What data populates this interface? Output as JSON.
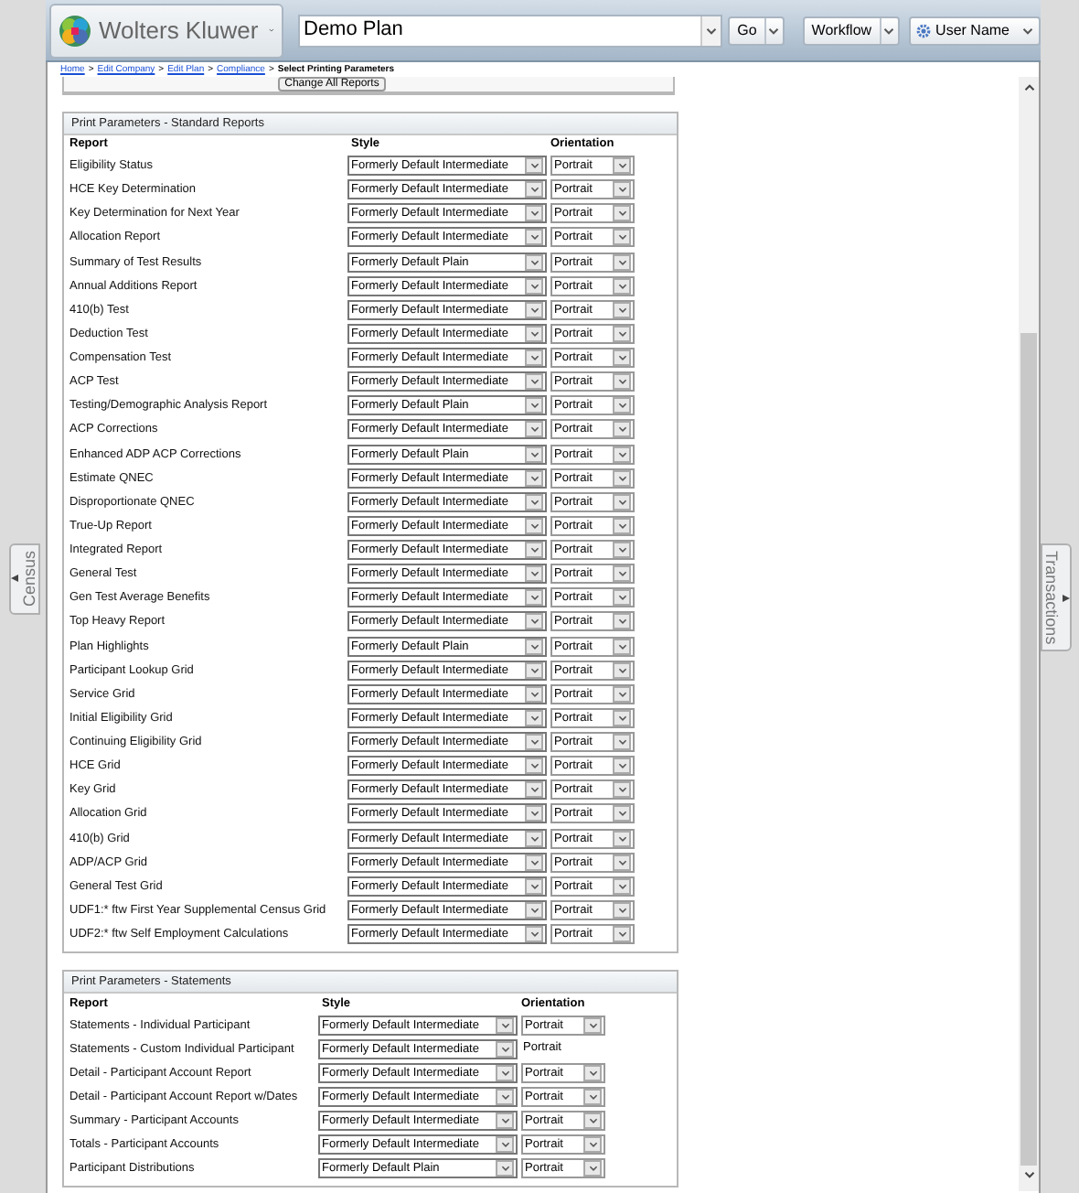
{
  "header": {
    "brand": "Wolters Kluwer",
    "plan_field": {
      "value": "Demo Plan"
    },
    "go_button": "Go",
    "workflow_button": "Workflow",
    "user_menu": "User Name"
  },
  "breadcrumb": [
    {
      "label": "Home",
      "link": true
    },
    {
      "separator": ">",
      "label": "Edit Company",
      "link": true
    },
    {
      "separator": ">",
      "label": "Edit Plan",
      "link": true
    },
    {
      "separator": ">",
      "label": "Compliance",
      "link": true
    },
    {
      "separator": ">",
      "label": "Select Printing Parameters",
      "link": false
    }
  ],
  "change_all_button": "Change All Reports",
  "standard_reports": {
    "title": "Print Parameters - Standard Reports",
    "columns": [
      "Report",
      "Style",
      "Orientation"
    ],
    "rows": [
      {
        "report": "Eligibility Status",
        "style": "Formerly Default Intermediate",
        "orientation": {
          "value": "Portrait",
          "kind": "select"
        }
      },
      {
        "report": "HCE Key Determination",
        "style": "Formerly Default Intermediate",
        "orientation": {
          "value": "Portrait",
          "kind": "select"
        }
      },
      {
        "report": "Key Determination for Next Year",
        "style": "Formerly Default Intermediate",
        "orientation": {
          "value": "Portrait",
          "kind": "select"
        }
      },
      {
        "report": "Allocation Report",
        "style": "Formerly Default Intermediate",
        "orientation": {
          "value": "Portrait",
          "kind": "select"
        }
      },
      {
        "report": "Summary of Test Results",
        "style": "Formerly Default Plain",
        "orientation": {
          "value": "Portrait",
          "kind": "select"
        }
      },
      {
        "report": "Annual Additions Report",
        "style": "Formerly Default Intermediate",
        "orientation": {
          "value": "Portrait",
          "kind": "select"
        }
      },
      {
        "report": "410(b) Test",
        "style": "Formerly Default Intermediate",
        "orientation": {
          "value": "Portrait",
          "kind": "select"
        }
      },
      {
        "report": "Deduction Test",
        "style": "Formerly Default Intermediate",
        "orientation": {
          "value": "Portrait",
          "kind": "select"
        }
      },
      {
        "report": "Compensation Test",
        "style": "Formerly Default Intermediate",
        "orientation": {
          "value": "Portrait",
          "kind": "select"
        }
      },
      {
        "report": "ACP Test",
        "style": "Formerly Default Intermediate",
        "orientation": {
          "value": "Portrait",
          "kind": "select"
        }
      },
      {
        "report": "Testing/Demographic Analysis Report",
        "style": "Formerly Default Plain",
        "orientation": {
          "value": "Portrait",
          "kind": "select"
        }
      },
      {
        "report": "ACP Corrections",
        "style": "Formerly Default Intermediate",
        "orientation": {
          "value": "Portrait",
          "kind": "select"
        }
      },
      {
        "report": "Enhanced ADP ACP Corrections",
        "style": "Formerly Default Plain",
        "orientation": {
          "value": "Portrait",
          "kind": "select"
        }
      },
      {
        "report": "Estimate QNEC",
        "style": "Formerly Default Intermediate",
        "orientation": {
          "value": "Portrait",
          "kind": "select"
        }
      },
      {
        "report": "Disproportionate QNEC",
        "style": "Formerly Default Intermediate",
        "orientation": {
          "value": "Portrait",
          "kind": "select"
        }
      },
      {
        "report": "True-Up Report",
        "style": "Formerly Default Intermediate",
        "orientation": {
          "value": "Portrait",
          "kind": "select"
        }
      },
      {
        "report": "Integrated Report",
        "style": "Formerly Default Intermediate",
        "orientation": {
          "value": "Portrait",
          "kind": "select"
        }
      },
      {
        "report": "General Test",
        "style": "Formerly Default Intermediate",
        "orientation": {
          "value": "Portrait",
          "kind": "select"
        }
      },
      {
        "report": "Gen Test Average Benefits",
        "style": "Formerly Default Intermediate",
        "orientation": {
          "value": "Portrait",
          "kind": "select"
        }
      },
      {
        "report": "Top Heavy Report",
        "style": "Formerly Default Intermediate",
        "orientation": {
          "value": "Portrait",
          "kind": "select"
        }
      },
      {
        "report": "Plan Highlights",
        "style": "Formerly Default Plain",
        "orientation": {
          "value": "Portrait",
          "kind": "select"
        }
      },
      {
        "report": "Participant Lookup Grid",
        "style": "Formerly Default Intermediate",
        "orientation": {
          "value": "Portrait",
          "kind": "select"
        }
      },
      {
        "report": "Service Grid",
        "style": "Formerly Default Intermediate",
        "orientation": {
          "value": "Portrait",
          "kind": "select"
        }
      },
      {
        "report": "Initial Eligibility Grid",
        "style": "Formerly Default Intermediate",
        "orientation": {
          "value": "Portrait",
          "kind": "select"
        }
      },
      {
        "report": "Continuing Eligibility Grid",
        "style": "Formerly Default Intermediate",
        "orientation": {
          "value": "Portrait",
          "kind": "select"
        }
      },
      {
        "report": "HCE Grid",
        "style": "Formerly Default Intermediate",
        "orientation": {
          "value": "Portrait",
          "kind": "select"
        }
      },
      {
        "report": "Key Grid",
        "style": "Formerly Default Intermediate",
        "orientation": {
          "value": "Portrait",
          "kind": "select"
        }
      },
      {
        "report": "Allocation Grid",
        "style": "Formerly Default Intermediate",
        "orientation": {
          "value": "Portrait",
          "kind": "select"
        }
      },
      {
        "report": "410(b) Grid",
        "style": "Formerly Default Intermediate",
        "orientation": {
          "value": "Portrait",
          "kind": "select"
        }
      },
      {
        "report": "ADP/ACP Grid",
        "style": "Formerly Default Intermediate",
        "orientation": {
          "value": "Portrait",
          "kind": "select"
        }
      },
      {
        "report": "General Test Grid",
        "style": "Formerly Default Intermediate",
        "orientation": {
          "value": "Portrait",
          "kind": "select"
        }
      },
      {
        "report": "UDF1:* ftw First Year Supplemental Census Grid",
        "style": "Formerly Default Intermediate",
        "orientation": {
          "value": "Portrait",
          "kind": "select"
        }
      },
      {
        "report": "UDF2:* ftw Self Employment Calculations",
        "style": "Formerly Default Intermediate",
        "orientation": {
          "value": "Portrait",
          "kind": "select"
        }
      }
    ]
  },
  "statements": {
    "title": "Print Parameters - Statements",
    "columns": [
      "Report",
      "Style",
      "Orientation"
    ],
    "rows": [
      {
        "report": "Statements - Individual Participant",
        "style": "Formerly Default Intermediate",
        "orientation": {
          "value": "Portrait",
          "kind": "select"
        }
      },
      {
        "report": "Statements - Custom Individual Participant",
        "style": "Formerly Default Intermediate",
        "orientation": {
          "value": "Portrait",
          "kind": "text"
        }
      },
      {
        "report": "Detail - Participant Account Report",
        "style": "Formerly Default Intermediate",
        "orientation": {
          "value": "Portrait",
          "kind": "select"
        }
      },
      {
        "report": "Detail - Participant Account Report w/Dates",
        "style": "Formerly Default Intermediate",
        "orientation": {
          "value": "Portrait",
          "kind": "select"
        }
      },
      {
        "report": "Summary - Participant Accounts",
        "style": "Formerly Default Intermediate",
        "orientation": {
          "value": "Portrait",
          "kind": "select"
        }
      },
      {
        "report": "Totals - Participant Accounts",
        "style": "Formerly Default Intermediate",
        "orientation": {
          "value": "Portrait",
          "kind": "select"
        }
      },
      {
        "report": "Participant Distributions",
        "style": "Formerly Default Plain",
        "orientation": {
          "value": "Portrait",
          "kind": "select"
        }
      }
    ]
  },
  "left_tab": {
    "label": "Census"
  },
  "right_tab": {
    "label": "Transactions"
  }
}
